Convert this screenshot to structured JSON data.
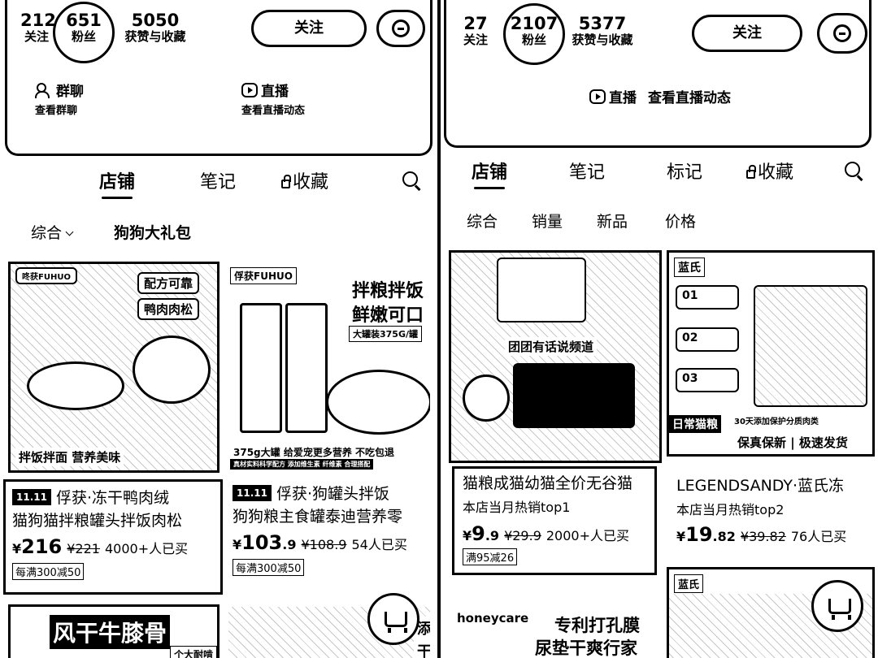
{
  "left": {
    "profile": {
      "following_count": "212",
      "following_label": "关注",
      "followers_count": "651",
      "followers_label": "粉丝",
      "likes_count": "5050",
      "likes_label": "获赞与收藏",
      "follow_button": "关注",
      "features": [
        {
          "title": "群聊",
          "subtitle": "查看群聊"
        },
        {
          "title": "直播",
          "subtitle": "查看直播动态"
        }
      ]
    },
    "tabs": [
      "店铺",
      "笔记",
      "收藏"
    ],
    "filters": [
      "综合",
      "狗狗大礼包"
    ],
    "products": [
      {
        "image_texts": [
          "咚获FUHUO",
          "配方可靠",
          "鸭肉肉松",
          "拌饭拌面 营养美味"
        ],
        "badge": "11.11",
        "title_line1": "俘获·冻干鸭肉绒",
        "title_line2": "猫狗猫拌粮罐头拌饭肉松",
        "currency": "¥",
        "price": "216",
        "orig_price": "¥221",
        "sold": "4000+人已买",
        "coupon": "每满300减50"
      },
      {
        "image_texts": [
          "俘获FUHUO",
          "拌粮拌饭",
          "鲜嫩可口",
          "大罐装375G/罐",
          "375g大罐 给爱宠更多营养 不吃包退",
          "真材实料科学配方 添加维生素 纤维素 合理搭配"
        ],
        "badge": "11.11",
        "title_line1": "俘获·狗罐头拌饭",
        "title_line2": "狗狗粮主食罐泰迪营养零",
        "currency": "¥",
        "price": "103",
        "price_dec": ".9",
        "orig_price": "¥108.9",
        "sold": "54人已买",
        "coupon": "每满300减50"
      },
      {
        "image_texts": [
          "风干牛膝骨",
          "个大耐啃"
        ]
      },
      {
        "image_texts": [
          "添",
          "干"
        ]
      }
    ]
  },
  "right": {
    "profile": {
      "following_count": "27",
      "following_label": "关注",
      "followers_count": "2107",
      "followers_label": "粉丝",
      "likes_count": "5377",
      "likes_label": "获赞与收藏",
      "follow_button": "关注",
      "live_title": "直播",
      "live_subtitle": "查看直播动态"
    },
    "tabs": [
      "店铺",
      "笔记",
      "标记",
      "收藏"
    ],
    "filters": [
      "综合",
      "销量",
      "新品",
      "价格"
    ],
    "products": [
      {
        "image_texts": [
          "团团有话说频道"
        ],
        "title": "猫粮成猫幼猫全价无谷猫",
        "rank": "本店当月热销top1",
        "currency": "¥",
        "price": "9",
        "price_dec": ".9",
        "orig_price": "¥29.9",
        "sold": "2000+人已买",
        "coupon": "满95减26"
      },
      {
        "image_texts": [
          "蓝氏",
          "01",
          "02",
          "03",
          "日常猫粮",
          "30天添加保护分质肉类",
          "保真保新 | 极速发货"
        ],
        "title": "LEGENDSANDY·蓝氏冻",
        "rank": "本店当月热销top2",
        "currency": "¥",
        "price": "19",
        "price_dec": ".82",
        "orig_price": "¥39.82",
        "sold": "76人已买"
      },
      {
        "image_texts": [
          "honeycare",
          "专利打孔膜",
          "尿垫干爽行家"
        ]
      },
      {
        "image_texts": [
          "蓝氏"
        ]
      }
    ]
  }
}
